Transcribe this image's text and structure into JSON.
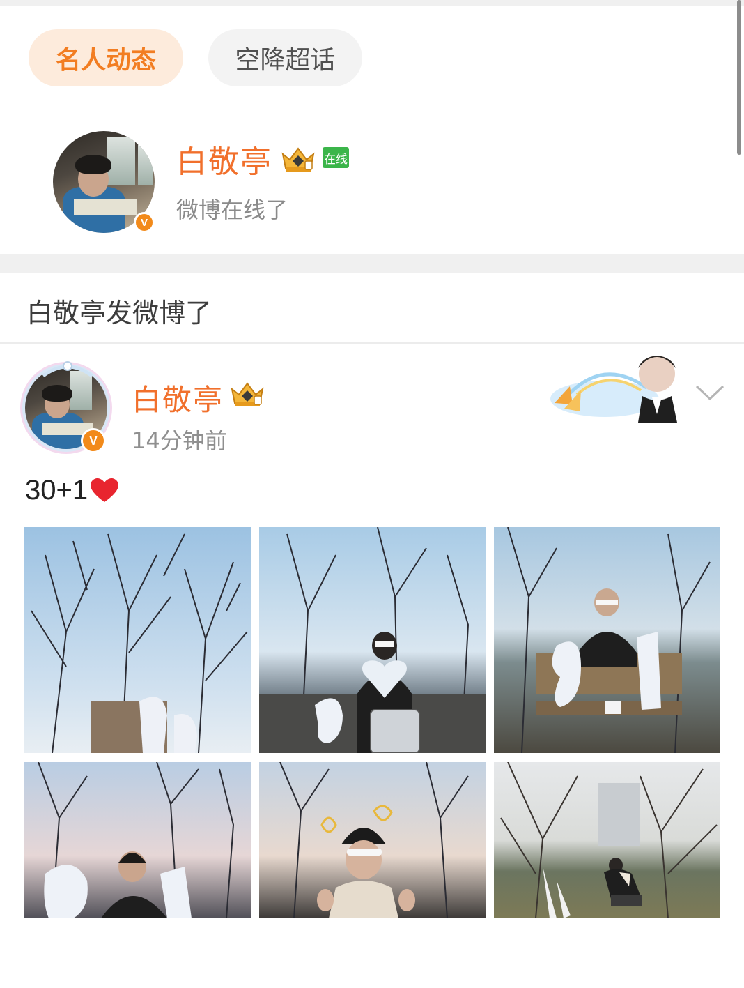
{
  "tabs": [
    {
      "label": "名人动态",
      "active": true
    },
    {
      "label": "空降超话",
      "active": false
    }
  ],
  "profile": {
    "name": "白敬亭",
    "online_badge": "在线",
    "status": "微博在线了",
    "verified_badge": "V"
  },
  "section": {
    "title": "白敬亭发微博了"
  },
  "post": {
    "author": "白敬亭",
    "time": "14分钟前",
    "text": "30+1",
    "verified_badge": "V",
    "photos": [
      {
        "desc": "bare trees sky balloon 31"
      },
      {
        "desc": "person holding heart balloon with 3"
      },
      {
        "desc": "person on bench with 3 1 balloons"
      },
      {
        "desc": "person with 3 1 balloons sunset"
      },
      {
        "desc": "person in beanie sunglasses"
      },
      {
        "desc": "person crouching in garden"
      }
    ]
  },
  "colors": {
    "accent": "#f1702c",
    "tab_active_bg": "#fdebdc",
    "online_green": "#3bb54a"
  },
  "icons": {
    "chevron": "chevron-down-icon",
    "heart": "heart-emoji-icon",
    "crown": "crown-badge-icon"
  }
}
